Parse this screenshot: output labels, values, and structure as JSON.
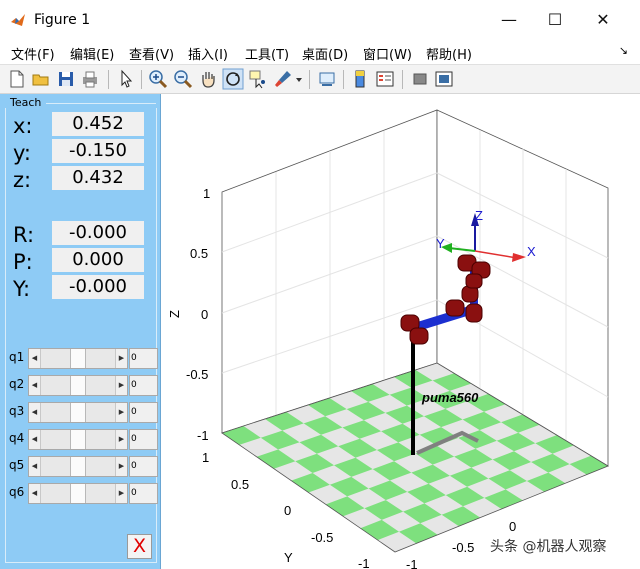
{
  "window": {
    "title": "Figure 1",
    "minimize": "—",
    "maximize": "☐",
    "close": "✕"
  },
  "menu": {
    "items": [
      "文件(F)",
      "编辑(E)",
      "查看(V)",
      "插入(I)",
      "工具(T)",
      "桌面(D)",
      "窗口(W)",
      "帮助(H)"
    ],
    "overflow": "↘"
  },
  "toolbar": {
    "icons": [
      "new-figure-icon",
      "open-icon",
      "save-icon",
      "print-icon",
      "pointer-icon",
      "zoom-in-icon",
      "zoom-out-icon",
      "pan-icon",
      "rotate-icon",
      "data-cursor-icon",
      "brush-icon",
      "dropdown-arrow-icon",
      "link-icon",
      "colorbar-icon",
      "legend-icon",
      "hide-plot-tools-icon",
      "show-plot-tools-icon"
    ]
  },
  "teach": {
    "legend": "Teach",
    "pose": [
      {
        "label": "x:",
        "value": "0.452"
      },
      {
        "label": "y:",
        "value": "-0.150"
      },
      {
        "label": "z:",
        "value": "0.432"
      },
      {
        "label": "R:",
        "value": "-0.000"
      },
      {
        "label": "P:",
        "value": "0.000"
      },
      {
        "label": "Y:",
        "value": "-0.000"
      }
    ],
    "joints": [
      {
        "label": "q1",
        "value": "0"
      },
      {
        "label": "q2",
        "value": "0"
      },
      {
        "label": "q3",
        "value": "0"
      },
      {
        "label": "q4",
        "value": "0"
      },
      {
        "label": "q5",
        "value": "0"
      },
      {
        "label": "q6",
        "value": "0"
      }
    ],
    "close_label": "X"
  },
  "plot": {
    "robot_name": "puma560",
    "zlabel": "Z",
    "ylabel": "Y",
    "z_ticks": [
      "1",
      "0.5",
      "0",
      "-0.5",
      "-1"
    ],
    "y_ticks": [
      "1",
      "0.5",
      "0",
      "-0.5",
      "-1"
    ],
    "x_ticks": [
      "0",
      "-0.5",
      "-1"
    ],
    "frame_axes": {
      "x": "X",
      "y": "Y",
      "z": "Z"
    },
    "colors": {
      "floor_a": "#7ee07e",
      "floor_b": "#e6e6e6",
      "link": "#1c2fd0",
      "joint": "#8a1010",
      "base": "#000000",
      "shadow": "#808080"
    }
  },
  "watermark": "头条 @机器人观察"
}
